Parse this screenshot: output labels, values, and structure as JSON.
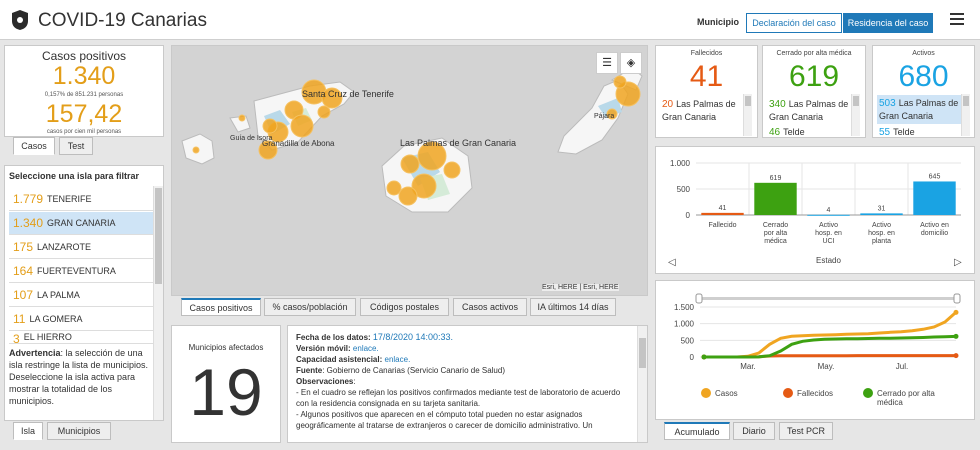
{
  "header": {
    "title": "COVID-19 Canarias",
    "filter_label": "Municipio",
    "toggle_left": "Declaración del caso",
    "toggle_right": "Residencia del caso"
  },
  "positives": {
    "title": "Casos positivos",
    "value": "1.340",
    "pct_text": "0,157% de 851.231 personas",
    "rate": "157,42",
    "rate_text": "casos por cien mil personas",
    "tabs": [
      "Casos",
      "Test"
    ]
  },
  "islands": {
    "heading": "Seleccione una isla para filtrar",
    "items": [
      {
        "count": "1.779",
        "name": "TENERIFE"
      },
      {
        "count": "1.340",
        "name": "GRAN CANARIA"
      },
      {
        "count": "175",
        "name": "LANZAROTE"
      },
      {
        "count": "164",
        "name": "FUERTEVENTURA"
      },
      {
        "count": "107",
        "name": "LA PALMA"
      },
      {
        "count": "11",
        "name": "LA GOMERA"
      },
      {
        "count": "3",
        "name": "EL HIERRO"
      }
    ],
    "warning_bold": "Advertencia",
    "warning_text": ": la selección de una isla restringe la lista de municipios. Deseleccione la isla activa para mostrar la totalidad de los municipios.",
    "tabs": [
      "Isla",
      "Municipios"
    ]
  },
  "map": {
    "labels": {
      "santa_cruz": "Santa Cruz de Tenerife",
      "guia": "Guía de Isora",
      "granadilla": "Granadilla de Abona",
      "las_palmas": "Las Palmas de Gran Canaria",
      "pajara": "Pájara"
    },
    "attribution": "Esri, HERE | Esri, HERE",
    "tabs": [
      "Casos positivos",
      "% casos/población",
      "Códigos postales",
      "Casos activos",
      "IA últimos 14 días"
    ]
  },
  "municipios": {
    "title": "Municipios afectados",
    "value": "19"
  },
  "info": {
    "fecha_label": "Fecha de los datos:",
    "fecha_value": "17/8/2020 14:00:33.",
    "movil_label": "Versión móvil:",
    "movil_value": "enlace.",
    "asistencial_label": "Capacidad asistencial:",
    "asistencial_value": "enlace.",
    "fuente_label": "Fuente",
    "fuente_value": ": Gobierno de Canarias (Servicio Canario de Salud)",
    "obs_label": "Observaciones",
    "obs_1": "- En el cuadro se reflejan los positivos confirmados mediante test de laboratorio de acuerdo con la residencia consignada en su tarjeta sanitaria.",
    "obs_2": "- Algunos positivos que aparecen en el cómputo total pueden no estar asignados geográficamente al tratarse de extranjeros o carecer de domicilio administrativo. Un"
  },
  "fallecidos": {
    "title": "Fallecidos",
    "value": "41",
    "row_num": "20",
    "row_text": "Las Palmas de Gran Canaria"
  },
  "cerrado": {
    "title": "Cerrado por alta médica",
    "value": "619",
    "row_num": "340",
    "row_text": "Las Palmas de Gran Canaria",
    "row2_num": "46",
    "row2_text": "Telde"
  },
  "activos": {
    "title": "Activos",
    "value": "680",
    "row_num": "503",
    "row_text": "Las Palmas de Gran Canaria",
    "row2_num": "55",
    "row2_text": "Telde"
  },
  "colors": {
    "orange": "#e55a14",
    "green": "#3da111",
    "blue": "#1aa3e3",
    "yellow": "#f0a521",
    "brand": "#1f79b8"
  },
  "bar_chart": {
    "type": "bar",
    "categories": [
      "Fallecido",
      "Cerrado por alta médica",
      "Activo hosp. en UCI",
      "Activo hosp. en planta",
      "Activo en domicilio"
    ],
    "values": [
      41,
      619,
      4,
      31,
      645
    ],
    "colors": [
      "#e55a14",
      "#3da111",
      "#1aa3e3",
      "#1aa3e3",
      "#1aa3e3"
    ],
    "xlabel": "Estado",
    "ylim": [
      0,
      1000
    ],
    "yticks": [
      "1.000",
      "500",
      "0"
    ]
  },
  "line_chart": {
    "type": "line",
    "x_ticks": [
      "Mar.",
      "May.",
      "Jul."
    ],
    "yticks": [
      "1.500",
      "1.000",
      "500",
      "0"
    ],
    "ylim": [
      0,
      1500
    ],
    "series": [
      {
        "name": "Casos",
        "color": "#f0a521"
      },
      {
        "name": "Fallecidos",
        "color": "#e55a14"
      },
      {
        "name": "Cerrado por alta médica",
        "color": "#3da111"
      }
    ],
    "tabs": [
      "Acumulado",
      "Diario",
      "Test PCR"
    ]
  }
}
